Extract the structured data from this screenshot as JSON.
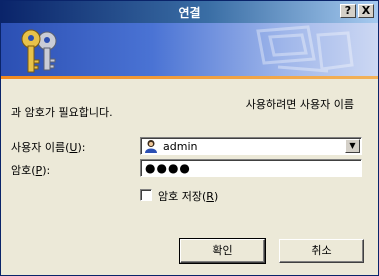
{
  "window": {
    "title": "연결",
    "help_button": "?",
    "close_button": "X"
  },
  "banner": {
    "icon": "keys-icon",
    "watermark": "computer-graphic-icon",
    "accent_color": "#f08a20"
  },
  "message": {
    "line1": "사용하려면 사용자 이름",
    "line2": "과 암호가 필요합니다."
  },
  "username": {
    "label_pre": "사용자 이름(",
    "label_key": "U",
    "label_post": "):",
    "value": "admin",
    "icon": "user-icon"
  },
  "password": {
    "label_pre": "암호(",
    "label_key": "P",
    "label_post": "):",
    "value": "●●●●"
  },
  "remember": {
    "label_pre": "암호 저장(",
    "label_key": "R",
    "label_post": ")",
    "checked": false
  },
  "buttons": {
    "ok": "확인",
    "cancel": "취소"
  }
}
